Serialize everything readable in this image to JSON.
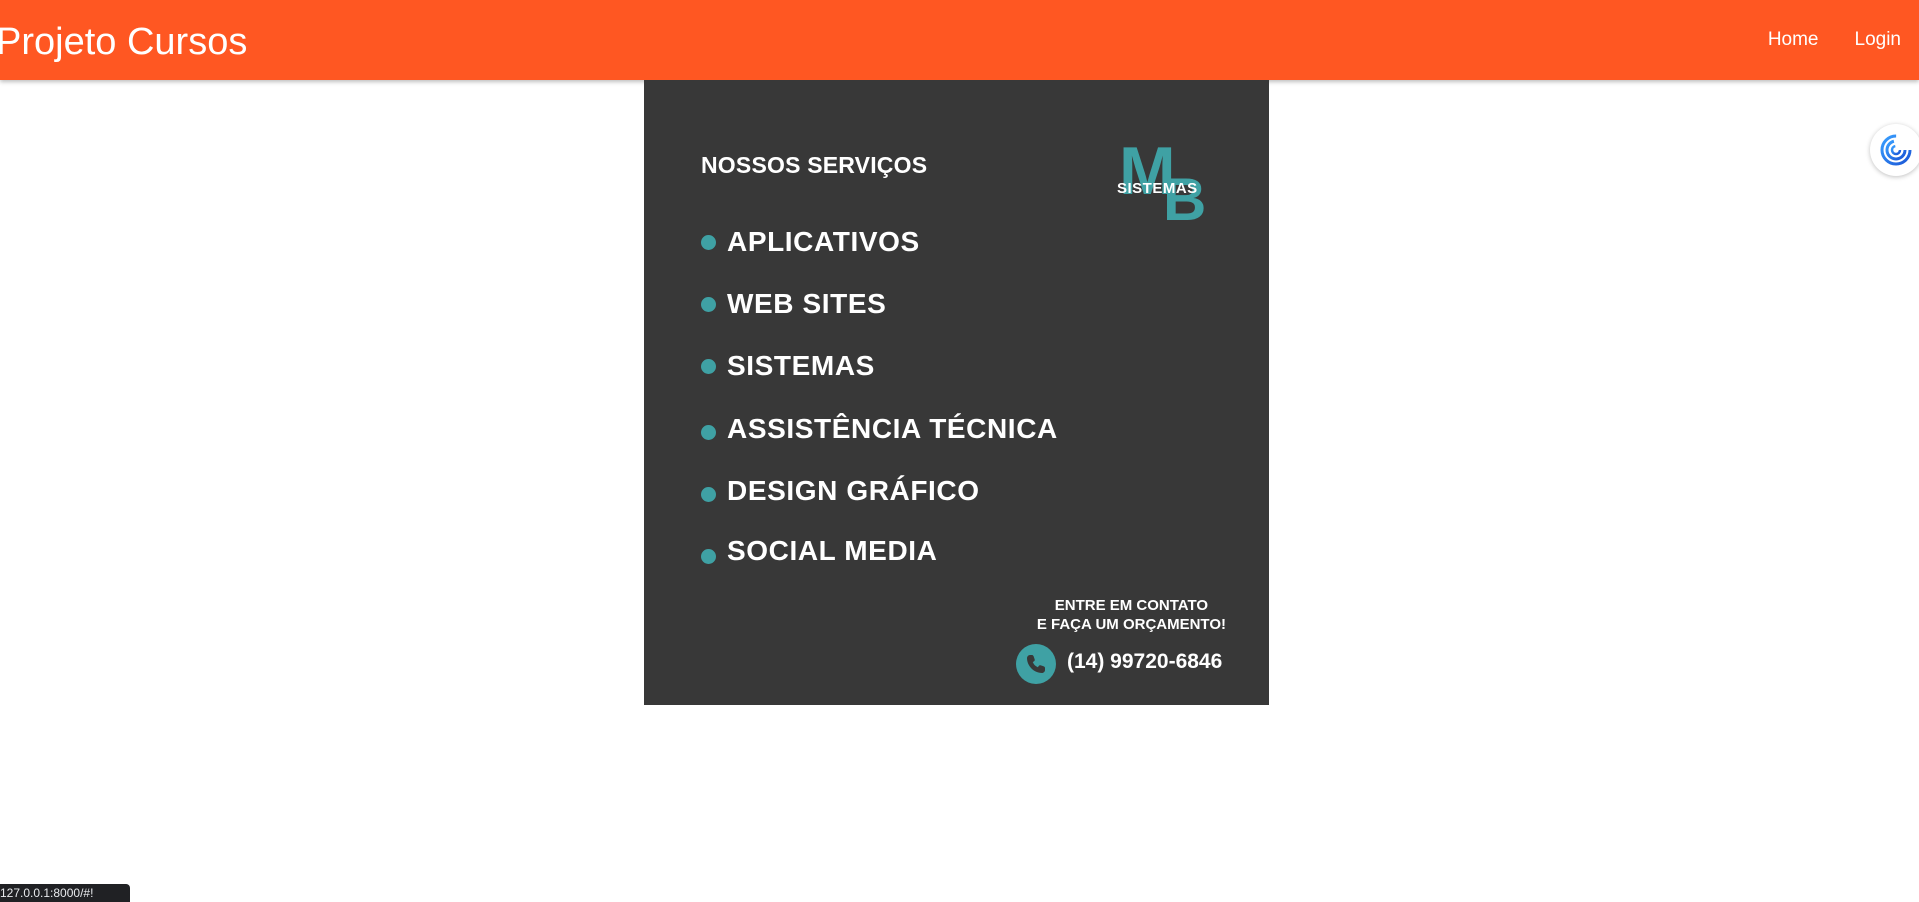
{
  "navbar": {
    "brand": "Projeto Cursos",
    "links": [
      "Home",
      "Login"
    ],
    "background_color": "#ff5722"
  },
  "banner": {
    "heading": "NOSSOS SERVIÇOS",
    "logo": {
      "letters": "MB",
      "tagline": "SISTEMAS",
      "color": "#3fa1a4"
    },
    "services": [
      "APLICATIVOS",
      "WEB SITES",
      "SISTEMAS",
      "ASSISTÊNCIA TÉCNICA",
      "DESIGN GRÁFICO",
      "SOCIAL MEDIA"
    ],
    "cta_line1": "ENTRE EM CONTATO",
    "cta_line2": "E FAÇA UM ORÇAMENTO!",
    "phone": "(14) 99720-6846",
    "phone_icon": "phone-icon",
    "background_color": "#383838",
    "accent_color": "#3fa1a4"
  },
  "side_widget": {
    "icon": "swirl-icon"
  },
  "status_bar": {
    "url": "127.0.0.1:8000/#!"
  }
}
